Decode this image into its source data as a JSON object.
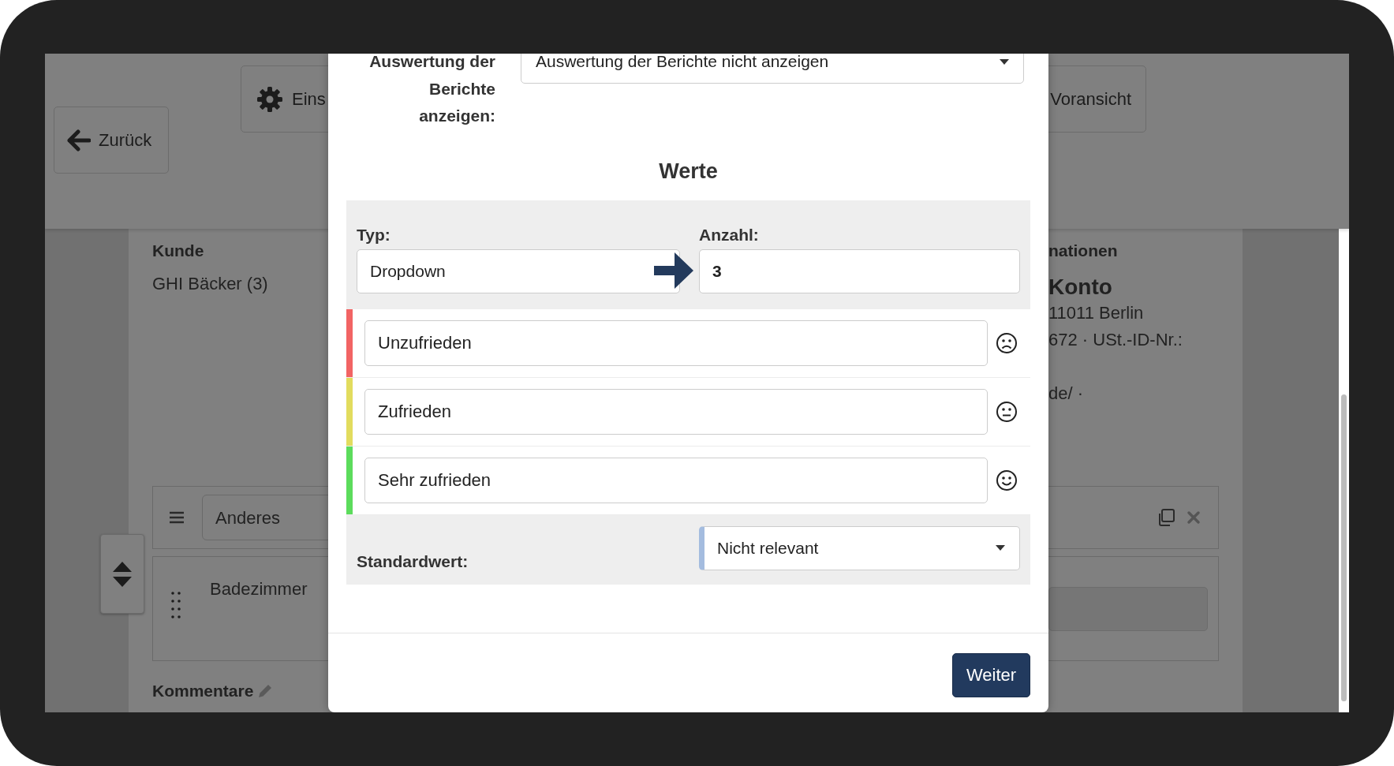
{
  "background": {
    "header_buttons": [
      {
        "label": "Zurück",
        "kind": "back"
      },
      {
        "label": "Eins",
        "kind": "settings"
      },
      {
        "label": "Voransicht",
        "kind": "plain"
      }
    ],
    "customer": {
      "heading": "Kunde",
      "value": "GHI Bäcker (3)"
    },
    "info": {
      "heading": "nationen",
      "name": "Konto",
      "lines": [
        "11011 Berlin",
        "672 · USt.-ID-Nr.:"
      ],
      "web": "de/ ·"
    },
    "section": {
      "field_value": "Anderes",
      "item": "Badezimmer"
    },
    "comments_label": "Kommentare"
  },
  "modal": {
    "report_setting": {
      "label": "Auswertung der Berichte anzeigen:",
      "value": "Auswertung der Berichte nicht anzeigen"
    },
    "heading": "Werte",
    "type": {
      "label": "Typ:",
      "value": "Dropdown"
    },
    "count": {
      "label": "Anzahl:",
      "value": "3"
    },
    "values": [
      {
        "text": "Unzufrieden",
        "color": "#f26464",
        "kind": "sad"
      },
      {
        "text": "Zufrieden",
        "color": "#e2dc5e",
        "kind": "neutral"
      },
      {
        "text": "Sehr zufrieden",
        "color": "#5cdc5c",
        "kind": "happy"
      }
    ],
    "default": {
      "label": "Standardwert:",
      "value": "Nicht relevant"
    },
    "next_button": "Weiter"
  }
}
